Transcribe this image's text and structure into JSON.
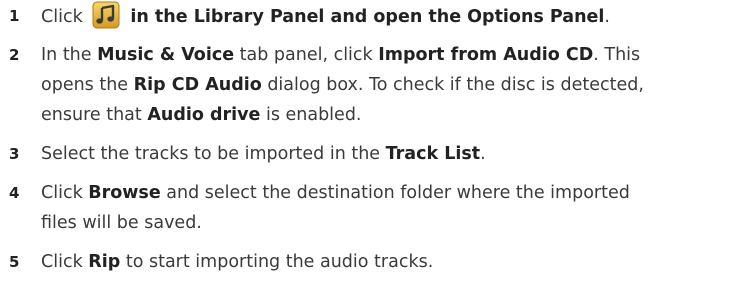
{
  "steps": [
    {
      "number": "1",
      "lines": [
        {
          "segments": [
            {
              "text": "Click ",
              "bold": false
            },
            {
              "icon": "music-note-icon"
            },
            {
              "text": " in the Library Panel and open the Options Panel",
              "bold": true
            },
            {
              "text": ".",
              "bold": false
            }
          ]
        }
      ]
    },
    {
      "number": "2",
      "lines": [
        {
          "segments": [
            {
              "text": "In the ",
              "bold": false
            },
            {
              "text": "Music & Voice",
              "bold": true
            },
            {
              "text": " tab panel, click ",
              "bold": false
            },
            {
              "text": "Import from Audio CD",
              "bold": true
            },
            {
              "text": ". This",
              "bold": false
            }
          ]
        },
        {
          "segments": [
            {
              "text": "opens the ",
              "bold": false
            },
            {
              "text": "Rip CD Audio",
              "bold": true
            },
            {
              "text": " dialog box. To check if the disc is detected,",
              "bold": false
            }
          ]
        },
        {
          "segments": [
            {
              "text": "ensure that ",
              "bold": false
            },
            {
              "text": "Audio drive",
              "bold": true
            },
            {
              "text": " is enabled.",
              "bold": false
            }
          ]
        }
      ]
    },
    {
      "number": "3",
      "lines": [
        {
          "segments": [
            {
              "text": "Select the tracks to be imported in the ",
              "bold": false
            },
            {
              "text": "Track List",
              "bold": true
            },
            {
              "text": ".",
              "bold": false
            }
          ]
        }
      ]
    },
    {
      "number": "4",
      "lines": [
        {
          "segments": [
            {
              "text": "Click ",
              "bold": false
            },
            {
              "text": "Browse",
              "bold": true
            },
            {
              "text": " and select the destination folder where the imported",
              "bold": false
            }
          ]
        },
        {
          "segments": [
            {
              "text": "files will be saved.",
              "bold": false
            }
          ]
        }
      ]
    },
    {
      "number": "5",
      "lines": [
        {
          "segments": [
            {
              "text": "Click ",
              "bold": false
            },
            {
              "text": "Rip",
              "bold": true
            },
            {
              "text": " to start importing the audio tracks.",
              "bold": false
            }
          ]
        }
      ]
    }
  ]
}
